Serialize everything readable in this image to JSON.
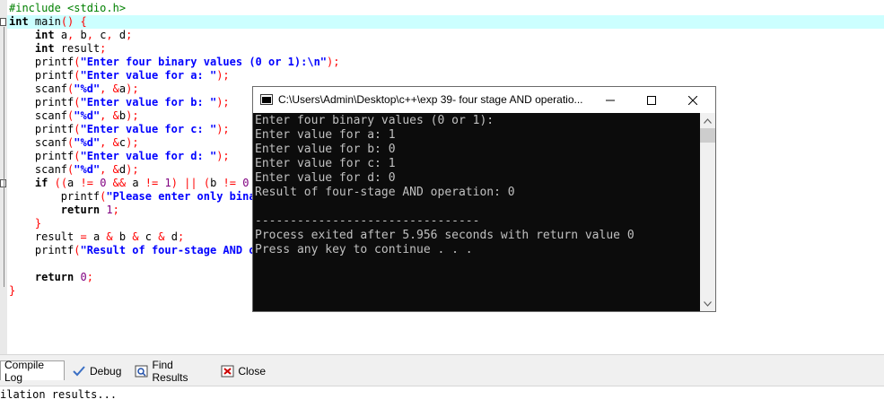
{
  "editor": {
    "lines": [
      [
        {
          "t": "pp",
          "s": "#include <stdio.h>"
        }
      ],
      [
        {
          "t": "kw",
          "s": "int"
        },
        {
          "t": "id",
          "s": " main"
        },
        {
          "t": "op",
          "s": "() {"
        }
      ],
      [
        {
          "t": "id",
          "s": "    "
        },
        {
          "t": "kw",
          "s": "int"
        },
        {
          "t": "id",
          "s": " a"
        },
        {
          "t": "op",
          "s": ","
        },
        {
          "t": "id",
          "s": " b"
        },
        {
          "t": "op",
          "s": ","
        },
        {
          "t": "id",
          "s": " c"
        },
        {
          "t": "op",
          "s": ","
        },
        {
          "t": "id",
          "s": " d"
        },
        {
          "t": "op",
          "s": ";"
        }
      ],
      [
        {
          "t": "id",
          "s": "    "
        },
        {
          "t": "kw",
          "s": "int"
        },
        {
          "t": "id",
          "s": " result"
        },
        {
          "t": "op",
          "s": ";"
        }
      ],
      [
        {
          "t": "id",
          "s": "    printf"
        },
        {
          "t": "op",
          "s": "("
        },
        {
          "t": "str",
          "s": "\"Enter four binary values (0 or 1):\\n\""
        },
        {
          "t": "op",
          "s": ");"
        }
      ],
      [
        {
          "t": "id",
          "s": "    printf"
        },
        {
          "t": "op",
          "s": "("
        },
        {
          "t": "str",
          "s": "\"Enter value for a: \""
        },
        {
          "t": "op",
          "s": ");"
        }
      ],
      [
        {
          "t": "id",
          "s": "    scanf"
        },
        {
          "t": "op",
          "s": "("
        },
        {
          "t": "str",
          "s": "\"%d\""
        },
        {
          "t": "op",
          "s": ", &"
        },
        {
          "t": "id",
          "s": "a"
        },
        {
          "t": "op",
          "s": ");"
        }
      ],
      [
        {
          "t": "id",
          "s": "    printf"
        },
        {
          "t": "op",
          "s": "("
        },
        {
          "t": "str",
          "s": "\"Enter value for b: \""
        },
        {
          "t": "op",
          "s": ");"
        }
      ],
      [
        {
          "t": "id",
          "s": "    scanf"
        },
        {
          "t": "op",
          "s": "("
        },
        {
          "t": "str",
          "s": "\"%d\""
        },
        {
          "t": "op",
          "s": ", &"
        },
        {
          "t": "id",
          "s": "b"
        },
        {
          "t": "op",
          "s": ");"
        }
      ],
      [
        {
          "t": "id",
          "s": "    printf"
        },
        {
          "t": "op",
          "s": "("
        },
        {
          "t": "str",
          "s": "\"Enter value for c: \""
        },
        {
          "t": "op",
          "s": ");"
        }
      ],
      [
        {
          "t": "id",
          "s": "    scanf"
        },
        {
          "t": "op",
          "s": "("
        },
        {
          "t": "str",
          "s": "\"%d\""
        },
        {
          "t": "op",
          "s": ", &"
        },
        {
          "t": "id",
          "s": "c"
        },
        {
          "t": "op",
          "s": ");"
        }
      ],
      [
        {
          "t": "id",
          "s": "    printf"
        },
        {
          "t": "op",
          "s": "("
        },
        {
          "t": "str",
          "s": "\"Enter value for d: \""
        },
        {
          "t": "op",
          "s": ");"
        }
      ],
      [
        {
          "t": "id",
          "s": "    scanf"
        },
        {
          "t": "op",
          "s": "("
        },
        {
          "t": "str",
          "s": "\"%d\""
        },
        {
          "t": "op",
          "s": ", &"
        },
        {
          "t": "id",
          "s": "d"
        },
        {
          "t": "op",
          "s": ");"
        }
      ],
      [
        {
          "t": "id",
          "s": "    "
        },
        {
          "t": "kw",
          "s": "if"
        },
        {
          "t": "id",
          "s": " "
        },
        {
          "t": "op",
          "s": "(("
        },
        {
          "t": "id",
          "s": "a "
        },
        {
          "t": "op",
          "s": "!="
        },
        {
          "t": "id",
          "s": " "
        },
        {
          "t": "num",
          "s": "0"
        },
        {
          "t": "id",
          "s": " "
        },
        {
          "t": "op",
          "s": "&&"
        },
        {
          "t": "id",
          "s": " a "
        },
        {
          "t": "op",
          "s": "!="
        },
        {
          "t": "id",
          "s": " "
        },
        {
          "t": "num",
          "s": "1"
        },
        {
          "t": "op",
          "s": ") || ("
        },
        {
          "t": "id",
          "s": "b "
        },
        {
          "t": "op",
          "s": "!="
        },
        {
          "t": "id",
          "s": " "
        },
        {
          "t": "num",
          "s": "0"
        },
        {
          "t": "id",
          "s": " "
        },
        {
          "t": "op",
          "s": "&"
        }
      ],
      [
        {
          "t": "id",
          "s": "        printf"
        },
        {
          "t": "op",
          "s": "("
        },
        {
          "t": "str",
          "s": "\"Please enter only binar"
        }
      ],
      [
        {
          "t": "id",
          "s": "        "
        },
        {
          "t": "kw",
          "s": "return"
        },
        {
          "t": "id",
          "s": " "
        },
        {
          "t": "num",
          "s": "1"
        },
        {
          "t": "op",
          "s": ";"
        }
      ],
      [
        {
          "t": "id",
          "s": "    "
        },
        {
          "t": "op",
          "s": "}"
        }
      ],
      [
        {
          "t": "id",
          "s": "    result "
        },
        {
          "t": "op",
          "s": "="
        },
        {
          "t": "id",
          "s": " a "
        },
        {
          "t": "op",
          "s": "&"
        },
        {
          "t": "id",
          "s": " b "
        },
        {
          "t": "op",
          "s": "&"
        },
        {
          "t": "id",
          "s": " c "
        },
        {
          "t": "op",
          "s": "&"
        },
        {
          "t": "id",
          "s": " d"
        },
        {
          "t": "op",
          "s": ";"
        }
      ],
      [
        {
          "t": "id",
          "s": "    printf"
        },
        {
          "t": "op",
          "s": "("
        },
        {
          "t": "str",
          "s": "\"Result of four-stage AND op"
        }
      ],
      [],
      [
        {
          "t": "id",
          "s": "    "
        },
        {
          "t": "kw",
          "s": "return"
        },
        {
          "t": "id",
          "s": " "
        },
        {
          "t": "num",
          "s": "0"
        },
        {
          "t": "op",
          "s": ";"
        }
      ],
      [
        {
          "t": "op",
          "s": "}"
        }
      ]
    ]
  },
  "console": {
    "title": "C:\\Users\\Admin\\Desktop\\c++\\exp 39- four stage AND operatio...",
    "minimize": "—",
    "maximize": "☐",
    "close": "✕",
    "lines": [
      "Enter four binary values (0 or 1):",
      "Enter value for a: 1",
      "Enter value for b: 0",
      "Enter value for c: 1",
      "Enter value for d: 0",
      "Result of four-stage AND operation: 0",
      "",
      "--------------------------------",
      "Process exited after 5.956 seconds with return value 0",
      "Press any key to continue . . ."
    ]
  },
  "tabs": {
    "compile_log": "Compile Log",
    "debug": "Debug",
    "find_results": "Find Results",
    "close": "Close"
  },
  "output": {
    "text": "ilation results..."
  }
}
